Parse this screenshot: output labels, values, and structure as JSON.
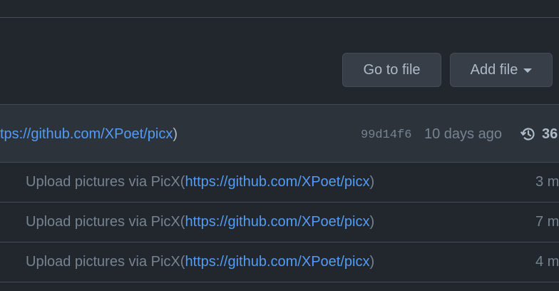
{
  "toolbar": {
    "go_to_file": "Go to file",
    "add_file": "Add file"
  },
  "latest_commit": {
    "message_link": "tps://github.com/XPoet/picx",
    "message_suffix": ")",
    "sha": "99d14f6",
    "time_ago": "10 days ago",
    "commit_count": "36"
  },
  "rows": [
    {
      "message_prefix": "Upload pictures via PicX(",
      "message_link": "https://github.com/XPoet/picx",
      "message_suffix": ")",
      "time": "3 m"
    },
    {
      "message_prefix": "Upload pictures via PicX(",
      "message_link": "https://github.com/XPoet/picx",
      "message_suffix": ")",
      "time": "7 m"
    },
    {
      "message_prefix": "Upload pictures via PicX(",
      "message_link": "https://github.com/XPoet/picx",
      "message_suffix": ")",
      "time": "4 m"
    }
  ],
  "icons": {
    "history": "history-icon",
    "caret": "caret-down-icon"
  },
  "colors": {
    "background": "#22272e",
    "header": "#2d333b",
    "link": "#539bf5",
    "border": "#444c56"
  }
}
